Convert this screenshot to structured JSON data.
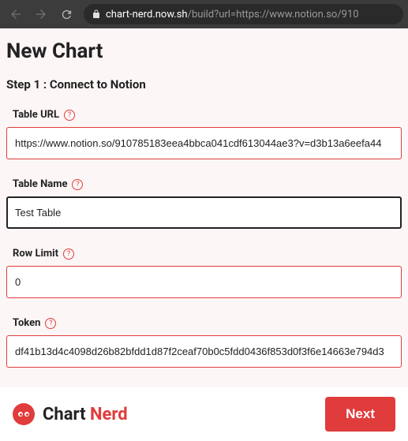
{
  "browser": {
    "url_domain": "chart-nerd.now.sh",
    "url_path": "/build?url=https://www.notion.so/910"
  },
  "page": {
    "title": "New Chart",
    "step_title": "Step 1 : Connect to Notion"
  },
  "form": {
    "table_url": {
      "label": "Table URL",
      "value": "https://www.notion.so/910785183eea4bbca041cdf613044ae3?v=d3b13a6eefa44"
    },
    "table_name": {
      "label": "Table Name",
      "value": "Test Table"
    },
    "row_limit": {
      "label": "Row Limit",
      "value": "0"
    },
    "token": {
      "label": "Token",
      "value": "df41b13d4c4098d26b82bfdd1d87f2ceaf70b0c5fdd0436f853d0f3f6e14663e794d3"
    }
  },
  "footer": {
    "brand_first": "Chart",
    "brand_second": "Nerd",
    "next_button": "Next"
  }
}
